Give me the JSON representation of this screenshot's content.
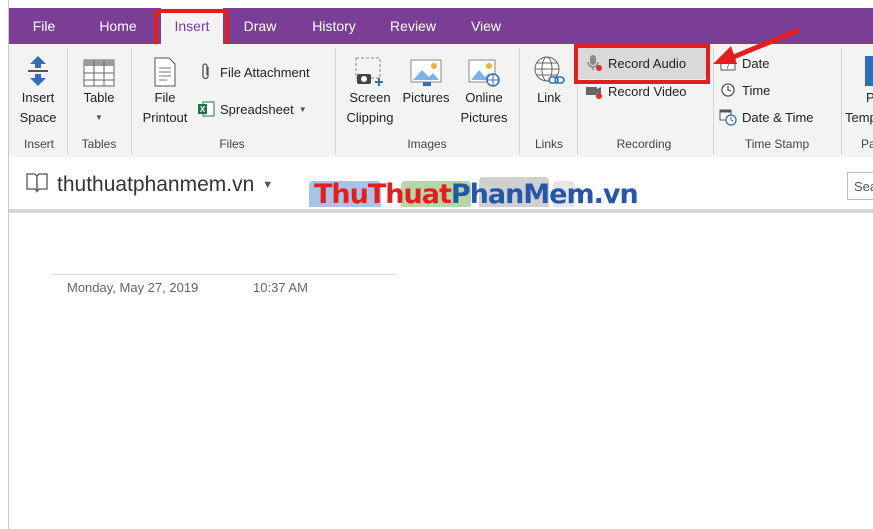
{
  "tabs": [
    {
      "label": "File",
      "active": false
    },
    {
      "label": "Home",
      "active": false
    },
    {
      "label": "Insert",
      "active": true
    },
    {
      "label": "Draw",
      "active": false
    },
    {
      "label": "History",
      "active": false
    },
    {
      "label": "Review",
      "active": false
    },
    {
      "label": "View",
      "active": false
    }
  ],
  "ribbon": {
    "insert_space": {
      "line1": "Insert",
      "line2": "Space"
    },
    "table": {
      "label": "Table"
    },
    "file_printout": {
      "line1": "File",
      "line2": "Printout"
    },
    "file_attachment": "File Attachment",
    "spreadsheet": "Spreadsheet",
    "screen_clipping": {
      "line1": "Screen",
      "line2": "Clipping"
    },
    "pictures": "Pictures",
    "online_pictures": {
      "line1": "Online",
      "line2": "Pictures"
    },
    "link": "Link",
    "record_audio": "Record Audio",
    "record_video": "Record Video",
    "date": "Date",
    "time": "Time",
    "date_time": "Date & Time",
    "page_templates": {
      "line1": "P",
      "line2": "Temp"
    },
    "groups": {
      "insert": "Insert",
      "tables": "Tables",
      "files": "Files",
      "images": "Images",
      "links": "Links",
      "recording": "Recording",
      "time_stamp": "Time Stamp",
      "pages": "Pa"
    }
  },
  "notebook": {
    "name": "thuthuatphanmem.vn"
  },
  "watermark": {
    "part1": "ThuThuat",
    "part2": "PhanMem",
    "part3": ".vn"
  },
  "search": {
    "placeholder": "Sea"
  },
  "page": {
    "date": "Monday, May 27, 2019",
    "time": "10:37 AM"
  },
  "colors": {
    "accent": "#7a3e97",
    "highlight": "#e21e1e"
  }
}
